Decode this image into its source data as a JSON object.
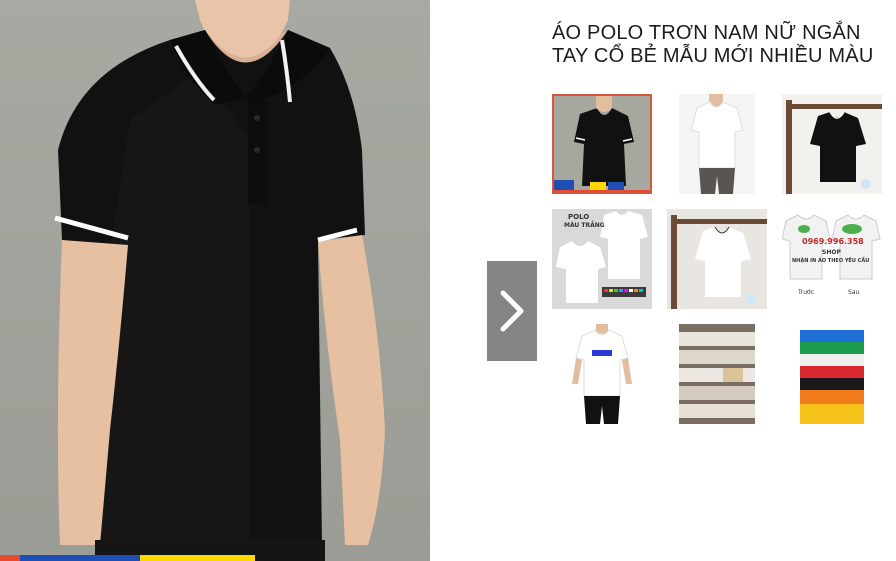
{
  "product": {
    "title": "ÁO POLO TRƠN NAM NỮ NGẮN\nTAY CỔ BẺ MẪU MỚI NHIỀU MÀU"
  },
  "main_image": {
    "alt": "Áo polo đen",
    "strip_colors": [
      "#e8492f",
      "#1f4fb4",
      "#ffd800"
    ]
  },
  "gallery": {
    "next_icon": "chevron-right-icon",
    "thumbnails": [
      {
        "name": "thumb-black-polo",
        "selected": true
      },
      {
        "name": "thumb-white-polo-model",
        "selected": false
      },
      {
        "name": "thumb-black-polo-hanger",
        "selected": false
      },
      {
        "name": "thumb-white-polo-colors",
        "selected": false,
        "label_title": "POLO",
        "label_sub": "MÀU TRẮNG"
      },
      {
        "name": "thumb-white-polo-hanger",
        "selected": false
      },
      {
        "name": "thumb-print-shop",
        "selected": false,
        "phone": "0969.996.358",
        "shop": "SHOP",
        "note": "NHẬN IN ÁO THEO YÊU CẦU",
        "front": "Trước",
        "back": "Sau"
      },
      {
        "name": "thumb-white-polo-print",
        "selected": false
      },
      {
        "name": "thumb-folded-stock",
        "selected": false
      },
      {
        "name": "thumb-color-stack",
        "selected": false
      }
    ]
  },
  "colors": {
    "selected_border": "#d9563a",
    "arrow_bg": "#858585"
  }
}
